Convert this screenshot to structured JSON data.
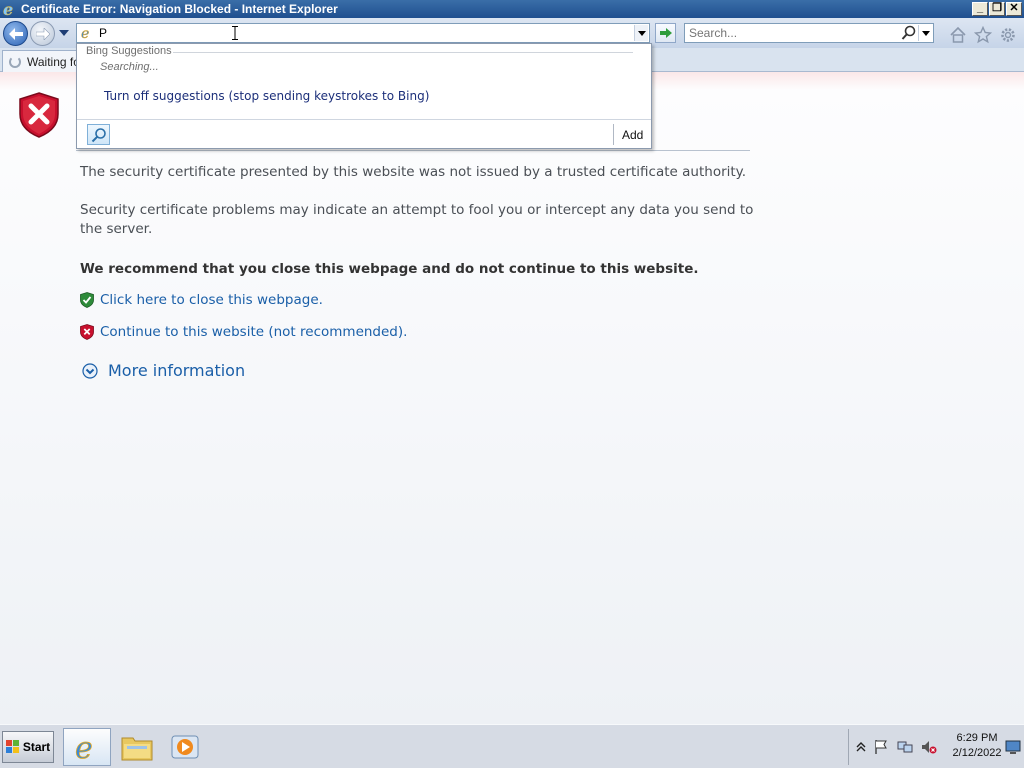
{
  "window": {
    "title": "Certificate Error: Navigation Blocked - Internet Explorer",
    "buttons": {
      "minimize": "_",
      "restore": "❐",
      "close": "✕"
    }
  },
  "navbar": {
    "address_value": "P",
    "search_placeholder": "Search..."
  },
  "tab": {
    "label": "Waiting fo"
  },
  "suggestions": {
    "header": "Bing Suggestions",
    "status": "Searching...",
    "turn_off": "Turn off suggestions (stop sending keystrokes to Bing)",
    "add_label": "Add"
  },
  "page": {
    "p1": "The security certificate presented by this website was not issued by a trusted certificate authority.",
    "p2": "Security certificate problems may indicate an attempt to fool you or intercept any data you send to the server.",
    "p3": "We recommend that you close this webpage and do not continue to this website.",
    "link_close": "Click here to close this webpage.",
    "link_continue": "Continue to this website (not recommended).",
    "more_info": "More information"
  },
  "taskbar": {
    "start_label": "Start",
    "time": "6:29 PM",
    "date": "2/12/2022"
  },
  "colors": {
    "link": "#1a5fa8",
    "error_red": "#c8102e",
    "ok_green": "#2e8b3a",
    "title_bar": "#2a5c9a"
  }
}
